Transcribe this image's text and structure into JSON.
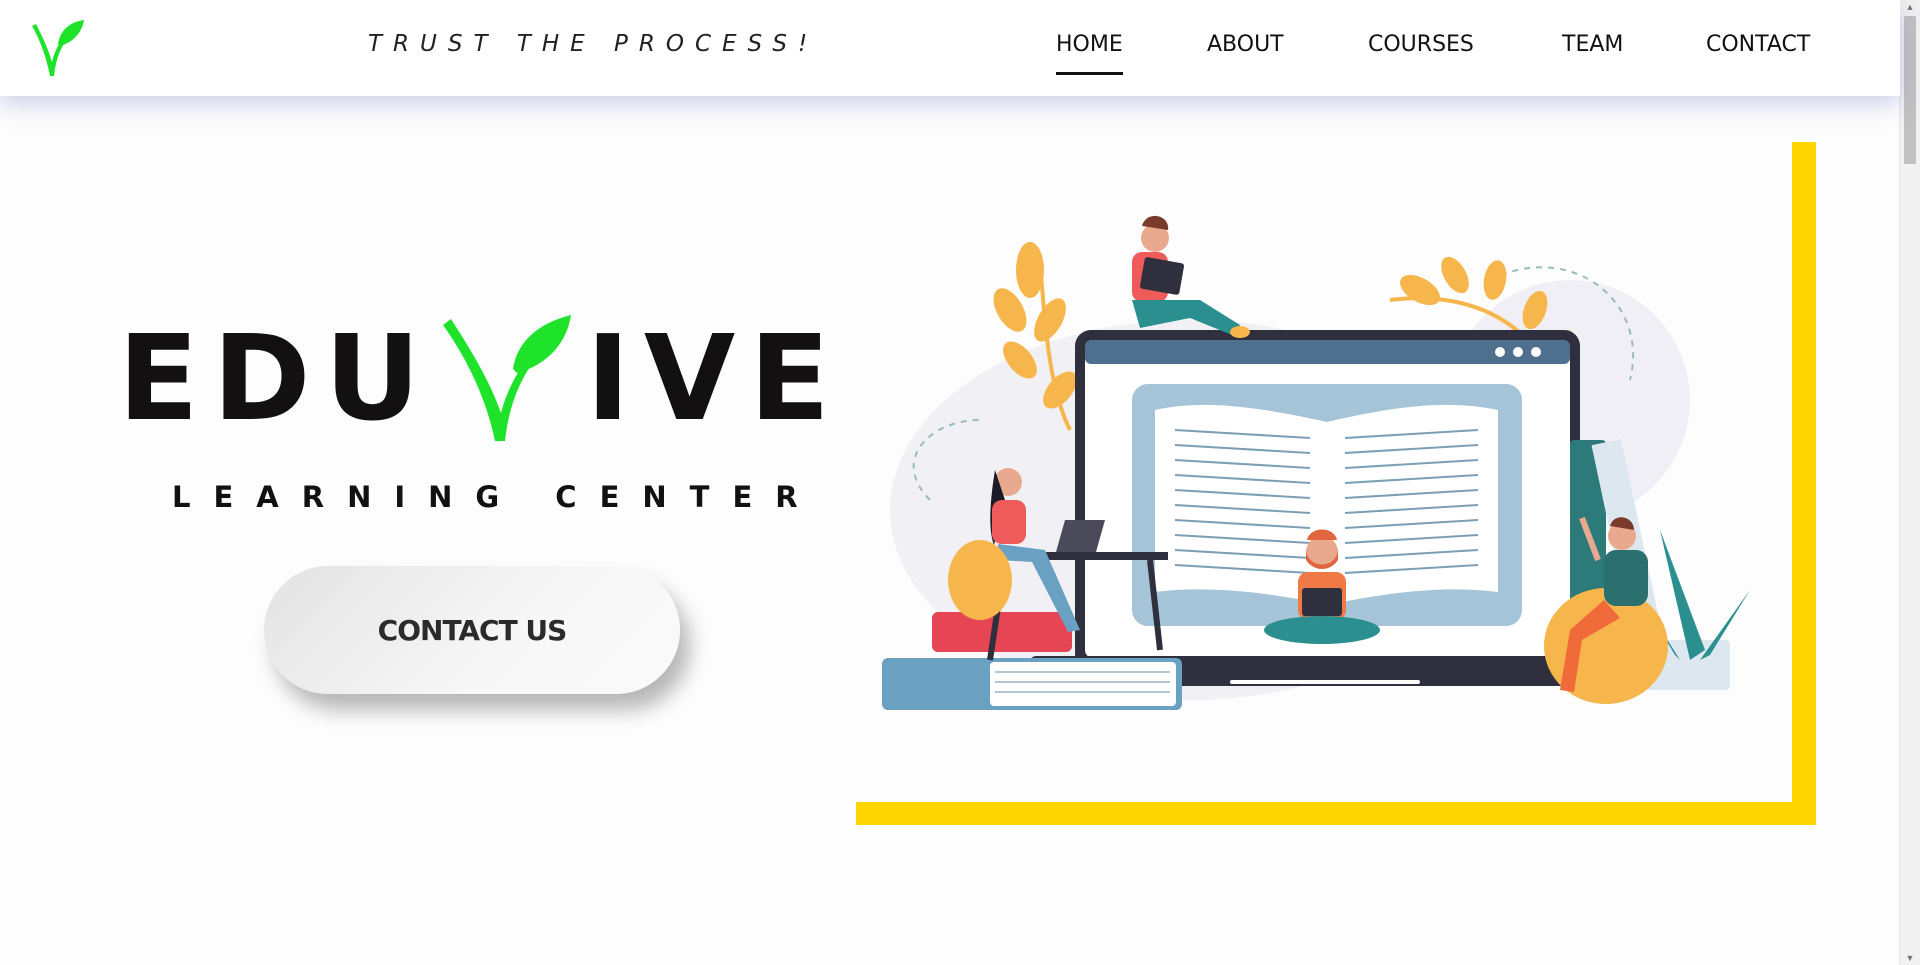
{
  "header": {
    "logo_icon": "leaf-v-logo",
    "tagline": "TRUST THE PROCESS!",
    "nav": [
      {
        "label": "HOME",
        "active": true
      },
      {
        "label": "ABOUT",
        "active": false
      },
      {
        "label": "COURSES",
        "active": false
      },
      {
        "label": "TEAM",
        "active": false
      },
      {
        "label": "CONTACT",
        "active": false
      }
    ]
  },
  "hero": {
    "brand_left": "EDU",
    "brand_right": "IVE",
    "brand_v_icon": "leaf-v-icon",
    "subtitle": "LEARNING CENTER",
    "cta_label": "CONTACT US",
    "illustration": "online-learning-illustration"
  },
  "colors": {
    "accent_green": "#1fe32b",
    "frame_yellow": "#ffd500",
    "text_dark": "#121010"
  }
}
